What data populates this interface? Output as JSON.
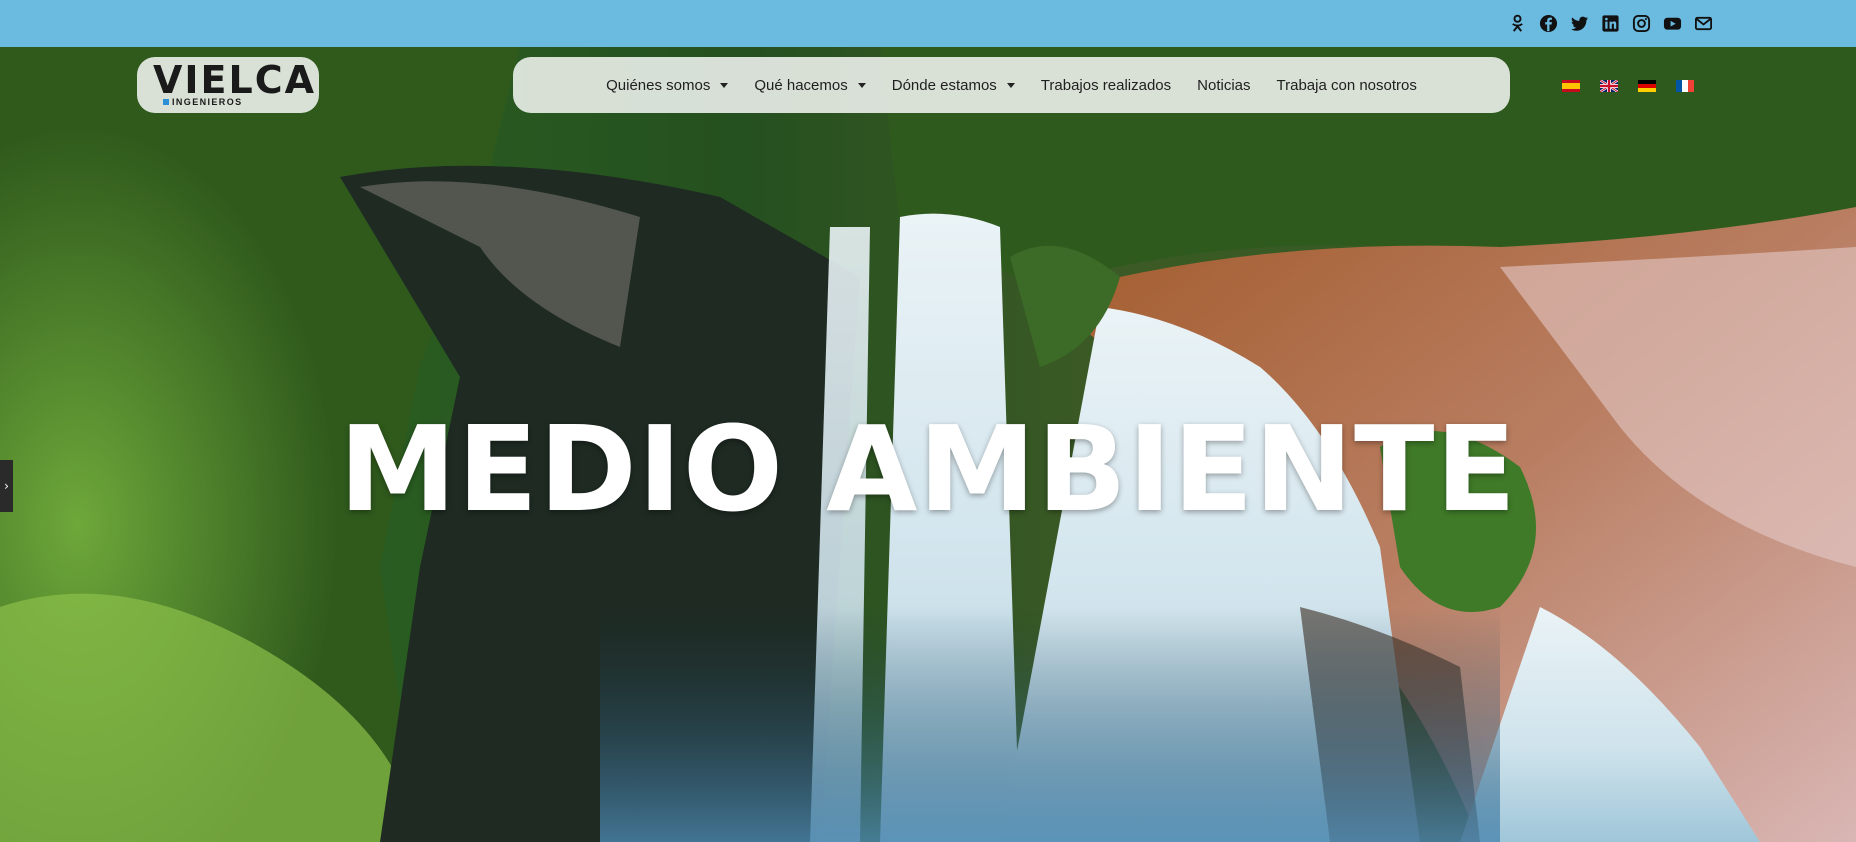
{
  "topbar": {
    "color": "#6bbbe0",
    "social_icons": [
      "odnoklassniki-icon",
      "facebook-icon",
      "twitter-icon",
      "linkedin-icon",
      "instagram-icon",
      "youtube-icon",
      "envelope-icon"
    ]
  },
  "logo": {
    "name": "VIELCA",
    "subtitle": "INGENIEROS"
  },
  "nav": {
    "items": [
      {
        "label": "Quiénes somos",
        "has_dropdown": true
      },
      {
        "label": "Qué hacemos",
        "has_dropdown": true
      },
      {
        "label": "Dónde estamos",
        "has_dropdown": true
      },
      {
        "label": "Trabajos realizados",
        "has_dropdown": false
      },
      {
        "label": "Noticias",
        "has_dropdown": false
      },
      {
        "label": "Trabaja con nosotros",
        "has_dropdown": false
      }
    ]
  },
  "languages": [
    "es-flag-icon",
    "en-flag-icon",
    "de-flag-icon",
    "fr-flag-icon"
  ],
  "hero": {
    "title": "MEDIO AMBIENTE"
  }
}
